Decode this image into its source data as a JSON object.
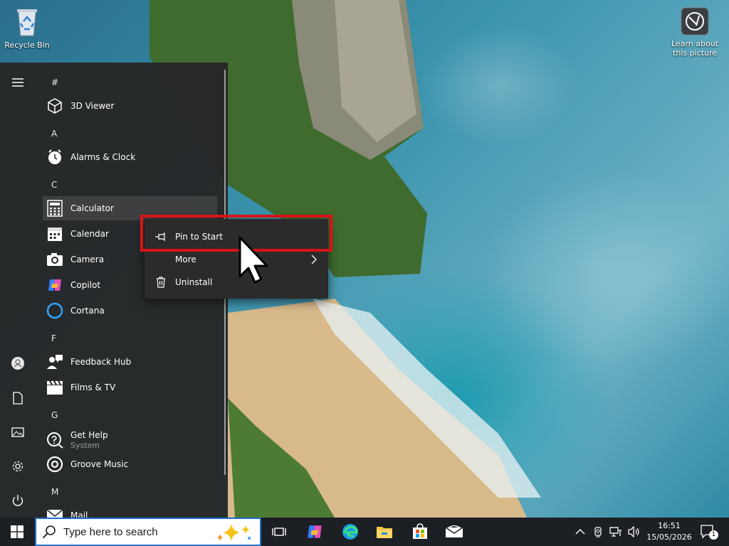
{
  "desktop": {
    "recycle_bin_label": "Recycle Bin",
    "learn_picture_label": "Learn about this picture"
  },
  "start_menu": {
    "rail": {
      "menu_icon": "hamburger-icon",
      "account_icon": "user-icon",
      "documents_icon": "document-icon",
      "pictures_icon": "pictures-icon",
      "settings_icon": "gear-icon",
      "power_icon": "power-icon"
    },
    "groups": [
      "#",
      "A",
      "C",
      "F",
      "G",
      "M"
    ],
    "apps": [
      {
        "label": "3D Viewer",
        "icon": "cube-icon"
      },
      {
        "label": "Alarms & Clock",
        "icon": "clock-icon"
      },
      {
        "label": "Calculator",
        "icon": "calculator-icon"
      },
      {
        "label": "Calendar",
        "icon": "calendar-icon"
      },
      {
        "label": "Camera",
        "icon": "camera-icon"
      },
      {
        "label": "Copilot",
        "icon": "copilot-icon"
      },
      {
        "label": "Cortana",
        "icon": "cortana-icon"
      },
      {
        "label": "Feedback Hub",
        "icon": "feedback-icon"
      },
      {
        "label": "Films & TV",
        "icon": "clapperboard-icon"
      },
      {
        "label": "Get Help",
        "sub": "System",
        "icon": "help-icon"
      },
      {
        "label": "Groove Music",
        "icon": "music-icon"
      },
      {
        "label": "Mail",
        "icon": "mail-icon"
      }
    ]
  },
  "context_menu": {
    "pin_to_start": "Pin to Start",
    "more": "More",
    "uninstall": "Uninstall"
  },
  "taskbar": {
    "search_placeholder": "Type here to search",
    "pinned": [
      "task-view-icon",
      "copilot-icon",
      "edge-icon",
      "file-explorer-icon",
      "store-icon",
      "mail-icon"
    ],
    "clock_time": "16:51",
    "clock_date": "15/05/2026",
    "notification_count": "1"
  },
  "colors": {
    "highlight_border": "#d81318",
    "start_bg": "#262626",
    "taskbar_bg": "#1c1f24",
    "search_border": "#1f6fc4"
  }
}
